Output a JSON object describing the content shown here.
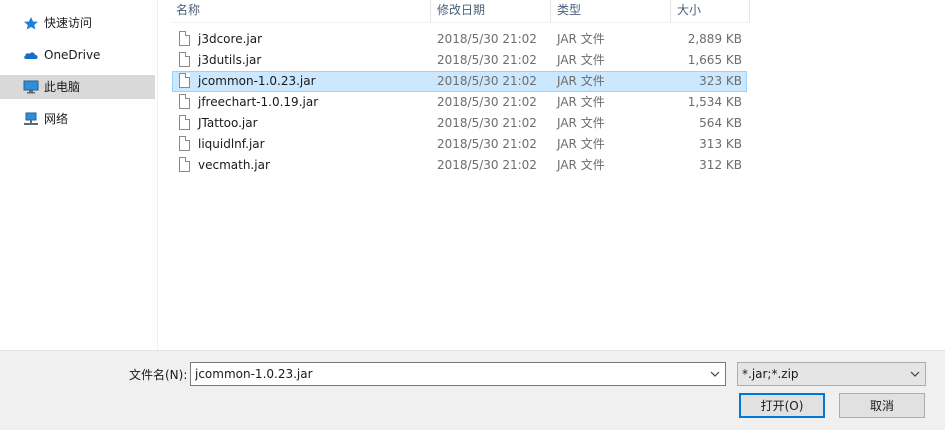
{
  "nav": {
    "items": [
      {
        "label": "快速访问",
        "icon": "quick-access-star-icon"
      },
      {
        "label": "OneDrive",
        "icon": "onedrive-cloud-icon"
      },
      {
        "label": "此电脑",
        "icon": "this-pc-monitor-icon",
        "selected": true
      },
      {
        "label": "网络",
        "icon": "network-icon"
      }
    ]
  },
  "columns": {
    "name": "名称",
    "date": "修改日期",
    "type": "类型",
    "size": "大小"
  },
  "files": [
    {
      "name": "j3dcore.jar",
      "date": "2018/5/30 21:02",
      "type": "JAR 文件",
      "size": "2,889 KB"
    },
    {
      "name": "j3dutils.jar",
      "date": "2018/5/30 21:02",
      "type": "JAR 文件",
      "size": "1,665 KB"
    },
    {
      "name": "jcommon-1.0.23.jar",
      "date": "2018/5/30 21:02",
      "type": "JAR 文件",
      "size": "323 KB",
      "selected": true
    },
    {
      "name": "jfreechart-1.0.19.jar",
      "date": "2018/5/30 21:02",
      "type": "JAR 文件",
      "size": "1,534 KB"
    },
    {
      "name": "JTattoo.jar",
      "date": "2018/5/30 21:02",
      "type": "JAR 文件",
      "size": "564 KB"
    },
    {
      "name": "liquidlnf.jar",
      "date": "2018/5/30 21:02",
      "type": "JAR 文件",
      "size": "313 KB"
    },
    {
      "name": "vecmath.jar",
      "date": "2018/5/30 21:02",
      "type": "JAR 文件",
      "size": "312 KB"
    }
  ],
  "bottom": {
    "filename_label": "文件名(N):",
    "filename_value": "jcommon-1.0.23.jar",
    "filter_value": "*.jar;*.zip",
    "open_label": "打开(O)",
    "cancel_label": "取消"
  },
  "colors": {
    "selection_bg": "#cce8ff",
    "selection_border": "#99d1ff",
    "accent": "#0078d7",
    "nav_selected": "#d9d9d9"
  }
}
